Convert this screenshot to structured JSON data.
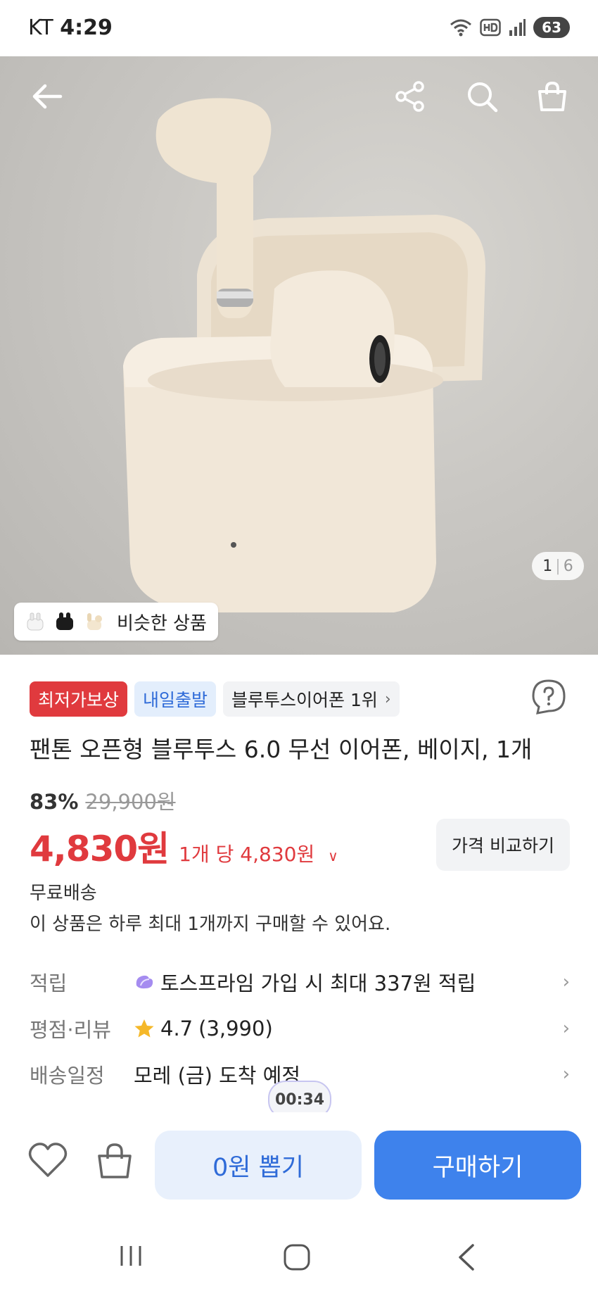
{
  "status_bar": {
    "carrier": "KT",
    "time": "4:29",
    "battery": "63",
    "icons": [
      "wifi-icon",
      "hd-icon",
      "signal-icon",
      "battery-icon"
    ]
  },
  "hero": {
    "image_counter_current": "1",
    "image_counter_separator": "|",
    "image_counter_total": "6",
    "similar_products_label": "비슷한 상품"
  },
  "badges": {
    "lowest_price": "최저가보상",
    "ship_tomorrow": "내일출발",
    "ranking": "블루투스이어폰 1위"
  },
  "product": {
    "title": "팬톤 오픈형 블루투스 6.0 무선 이어폰, 베이지, 1개",
    "discount_rate": "83%",
    "original_price": "29,900원",
    "sale_price": "4,830원",
    "unit_price": "1개 당 4,830원",
    "compare_button": "가격 비교하기",
    "free_shipping": "무료배송",
    "purchase_limit": "이 상품은 하루 최대 1개까지 구매할 수 있어요."
  },
  "info_rows": {
    "points": {
      "label": "적립",
      "value": "토스프라임 가입 시 최대 337원 적립"
    },
    "rating": {
      "label": "평점·리뷰",
      "score": "4.7",
      "count": "(3,990)"
    },
    "delivery": {
      "label": "배송일정",
      "value": "모레 (금) 도착 예정"
    }
  },
  "timer": "00:34",
  "bottom_bar": {
    "draw_button": "0원 뽑기",
    "buy_button": "구매하기"
  },
  "colors": {
    "accent_red": "#e03a3e",
    "accent_blue": "#3e82ec",
    "light_blue": "#e8f0fc"
  }
}
